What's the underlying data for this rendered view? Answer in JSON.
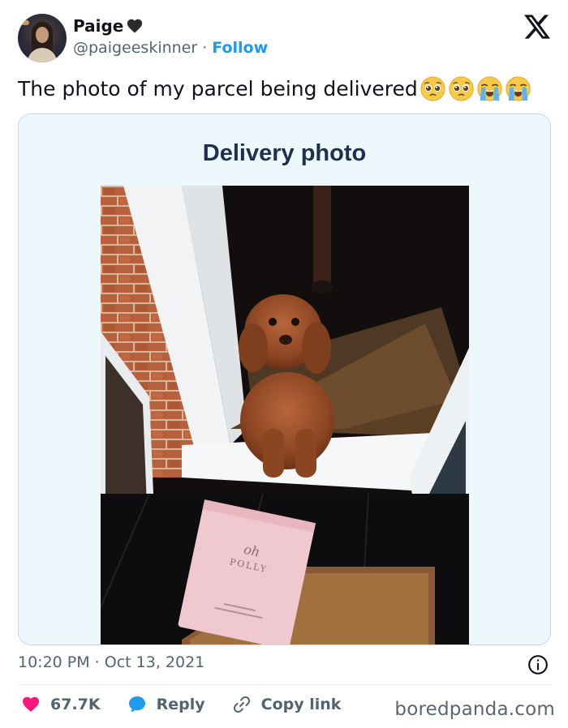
{
  "author": {
    "name": "Paige",
    "name_emoji": "black-heart",
    "handle": "@paigeeskinner",
    "separator": "·",
    "follow_label": "Follow"
  },
  "tweet": {
    "text": "The photo of my parcel being delivered",
    "emojis": [
      "pleading-face-emoji",
      "pleading-face-emoji",
      "loudly-crying-face-emoji",
      "loudly-crying-face-emoji"
    ]
  },
  "media": {
    "card_title": "Delivery photo",
    "parcel_brand_script": "oh",
    "parcel_brand": "POLLY"
  },
  "timestamp": "10:20 PM · Oct 13, 2021",
  "actions": {
    "like_count": "67.7K",
    "reply_label": "Reply",
    "copy_link_label": "Copy link"
  },
  "watermark": "boredpanda.com",
  "colors": {
    "accent_blue": "#1d9bf0",
    "like_pink": "#f91880",
    "secondary_text": "#536471",
    "card_background": "#ecf8fb",
    "card_title": "#1f2f4d"
  }
}
